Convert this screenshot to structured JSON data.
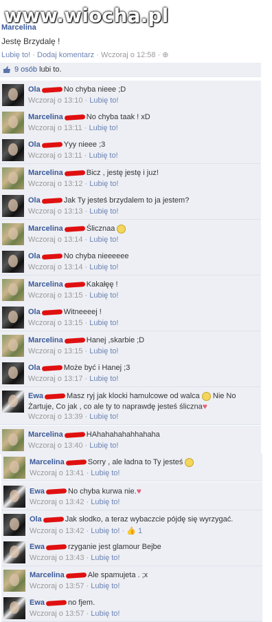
{
  "watermark": "www.wiocha.pl",
  "post": {
    "author": "Marcelina",
    "text": "Jestę Brzydalę !",
    "meta": {
      "like": "Lubię to!",
      "comment": "Dodaj komentarz",
      "time": "Wczoraj o 12:58",
      "sep": "·"
    }
  },
  "likes": {
    "count_text": "9 osób",
    "suffix": "lubi to."
  },
  "comments": [
    {
      "author": "Ola",
      "avatar": "ola",
      "text": "No chyba nieee ;D",
      "time": "Wczoraj o 13:10",
      "like": "Lubię to!"
    },
    {
      "author": "Marcelina",
      "avatar": "marc",
      "text": "No chyba taak ! xD",
      "time": "Wczoraj o 13:11",
      "like": "Lubię to!"
    },
    {
      "author": "Ola",
      "avatar": "ola",
      "text": "Yyy nieee ;3",
      "time": "Wczoraj o 13:11",
      "like": "Lubię to!"
    },
    {
      "author": "Marcelina",
      "avatar": "marc",
      "text": "Bicz , jestę jestę i juz!",
      "time": "Wczoraj o 13:12",
      "like": "Lubię to!"
    },
    {
      "author": "Ola",
      "avatar": "ola",
      "text": "Jak Ty jesteś brzydalem to ja jestem?",
      "time": "Wczoraj o 13:13",
      "like": "Lubię to!"
    },
    {
      "author": "Marcelina",
      "avatar": "marc",
      "text": "Ślicznaa",
      "time": "Wczoraj o 13:14",
      "like": "Lubię to!"
    },
    {
      "author": "Ola",
      "avatar": "ola",
      "text": "No chyba nieeeeee",
      "time": "Wczoraj o 13:14",
      "like": "Lubię to!"
    },
    {
      "author": "Marcelina",
      "avatar": "marc",
      "text": "Kakałęę !",
      "time": "Wczoraj o 13:15",
      "like": "Lubię to!"
    },
    {
      "author": "Ola",
      "avatar": "ola",
      "text": "Witneeeej !",
      "time": "Wczoraj o 13:15",
      "like": "Lubię to!"
    },
    {
      "author": "Marcelina",
      "avatar": "marc",
      "text": "Hanej ,skarbie ;D",
      "time": "Wczoraj o 13:15",
      "like": "Lubię to!"
    },
    {
      "author": "Ola",
      "avatar": "ola",
      "text": "Może być i Hanej ;3",
      "time": "Wczoraj o 13:17",
      "like": "Lubię to!"
    },
    {
      "author": "Ewa",
      "avatar": "ewa",
      "text": "Masz ryj jak klocki hamulcowe od walca",
      "text2": "Nie No Żartuje, Co jak , co ale ty to naprawdę jesteś śliczna",
      "time": "Wczoraj o 13:39",
      "like": "Lubię to!"
    },
    {
      "author": "Marcelina",
      "avatar": "marc",
      "text": "HAhahahahahhahaha",
      "time": "Wczoraj o 13:40",
      "like": "Lubię to!"
    },
    {
      "author": "Marcelina",
      "avatar": "marc",
      "text": "Sorry , ale ładna to Ty jesteś",
      "time": "Wczoraj o 13:41",
      "like": "Lubię to!"
    },
    {
      "author": "Ewa",
      "avatar": "ewa",
      "text": "No chyba kurwa nie.",
      "time": "Wczoraj o 13:42",
      "like": "Lubię to!"
    },
    {
      "author": "Ola",
      "avatar": "ola",
      "text": "Jak słodko, a teraz wybaczcie pójdę się wyrzygać.",
      "time": "Wczoraj o 13:42",
      "like": "Lubię to!",
      "likes": "1"
    },
    {
      "author": "Ewa",
      "avatar": "ewa",
      "text": "rzyganie jest glamour Bejbe",
      "time": "Wczoraj o 13:43",
      "like": "Lubię to!"
    },
    {
      "author": "Marcelina",
      "avatar": "marc",
      "text": "Ale spamujeta . ;x",
      "time": "Wczoraj o 13:57",
      "like": "Lubię to!"
    },
    {
      "author": "Ewa",
      "avatar": "ewa",
      "text": "no fjem.",
      "time": "Wczoraj o 13:57",
      "like": "Lubię to!"
    }
  ],
  "icons": {
    "like": "thumbs-up-icon",
    "smiley": "smiley-icon",
    "heart": "heart-icon"
  },
  "colors": {
    "link": "#3b5998",
    "comment_bg": "#edeff4",
    "redaction": "#e01010"
  }
}
